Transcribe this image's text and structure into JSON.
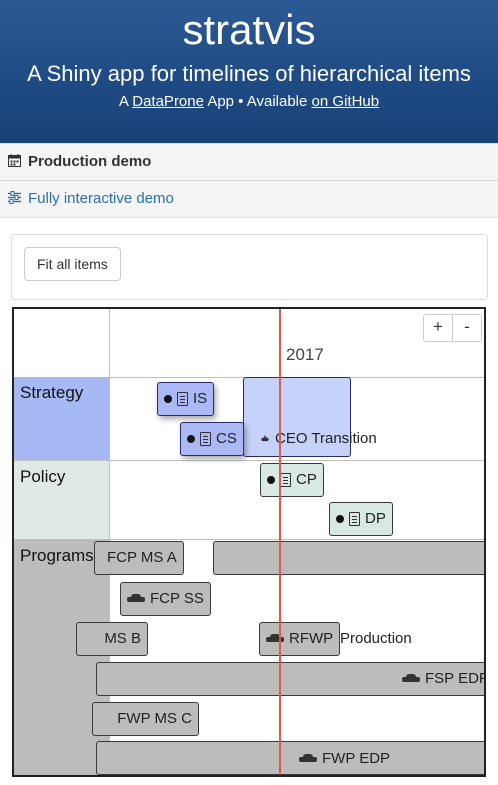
{
  "header": {
    "title": "stratvis",
    "subtitle": "A Shiny app for timelines of hierarchical items",
    "credit_prefix": "A",
    "credit_link1": "DataProne",
    "credit_mid": "App • Available",
    "credit_link2": "on GitHub"
  },
  "sections": {
    "production_demo": "Production demo",
    "interactive_demo": "Fully interactive demo"
  },
  "toolbar": {
    "fit_all_label": "Fit all items"
  },
  "timeline": {
    "year_label": "2017",
    "zoom_in": "+",
    "zoom_out": "-",
    "groups": {
      "strategy": "Strategy",
      "policy": "Policy",
      "programs": "Programs"
    },
    "items": {
      "is": "IS",
      "cs": "CS",
      "ceo": "CEO Transition",
      "cp": "CP",
      "dp": "DP",
      "fcp_ms_a": "FCP MS A",
      "fcp_ss": "FCP SS",
      "ms_b": "MS B",
      "rfwp": "RFWP",
      "production": "Production",
      "fsp_edp": "FSP EDP",
      "fwp_ms_c": "FWP MS C",
      "fwp_edp": "FWP EDP"
    }
  },
  "colors": {
    "header_bg": "#1f4b84",
    "strategy_group": "#a6b9f5",
    "policy_group": "#dfeae6",
    "programs_group": "#bcbcbc",
    "current_time": "#e05a4a"
  }
}
